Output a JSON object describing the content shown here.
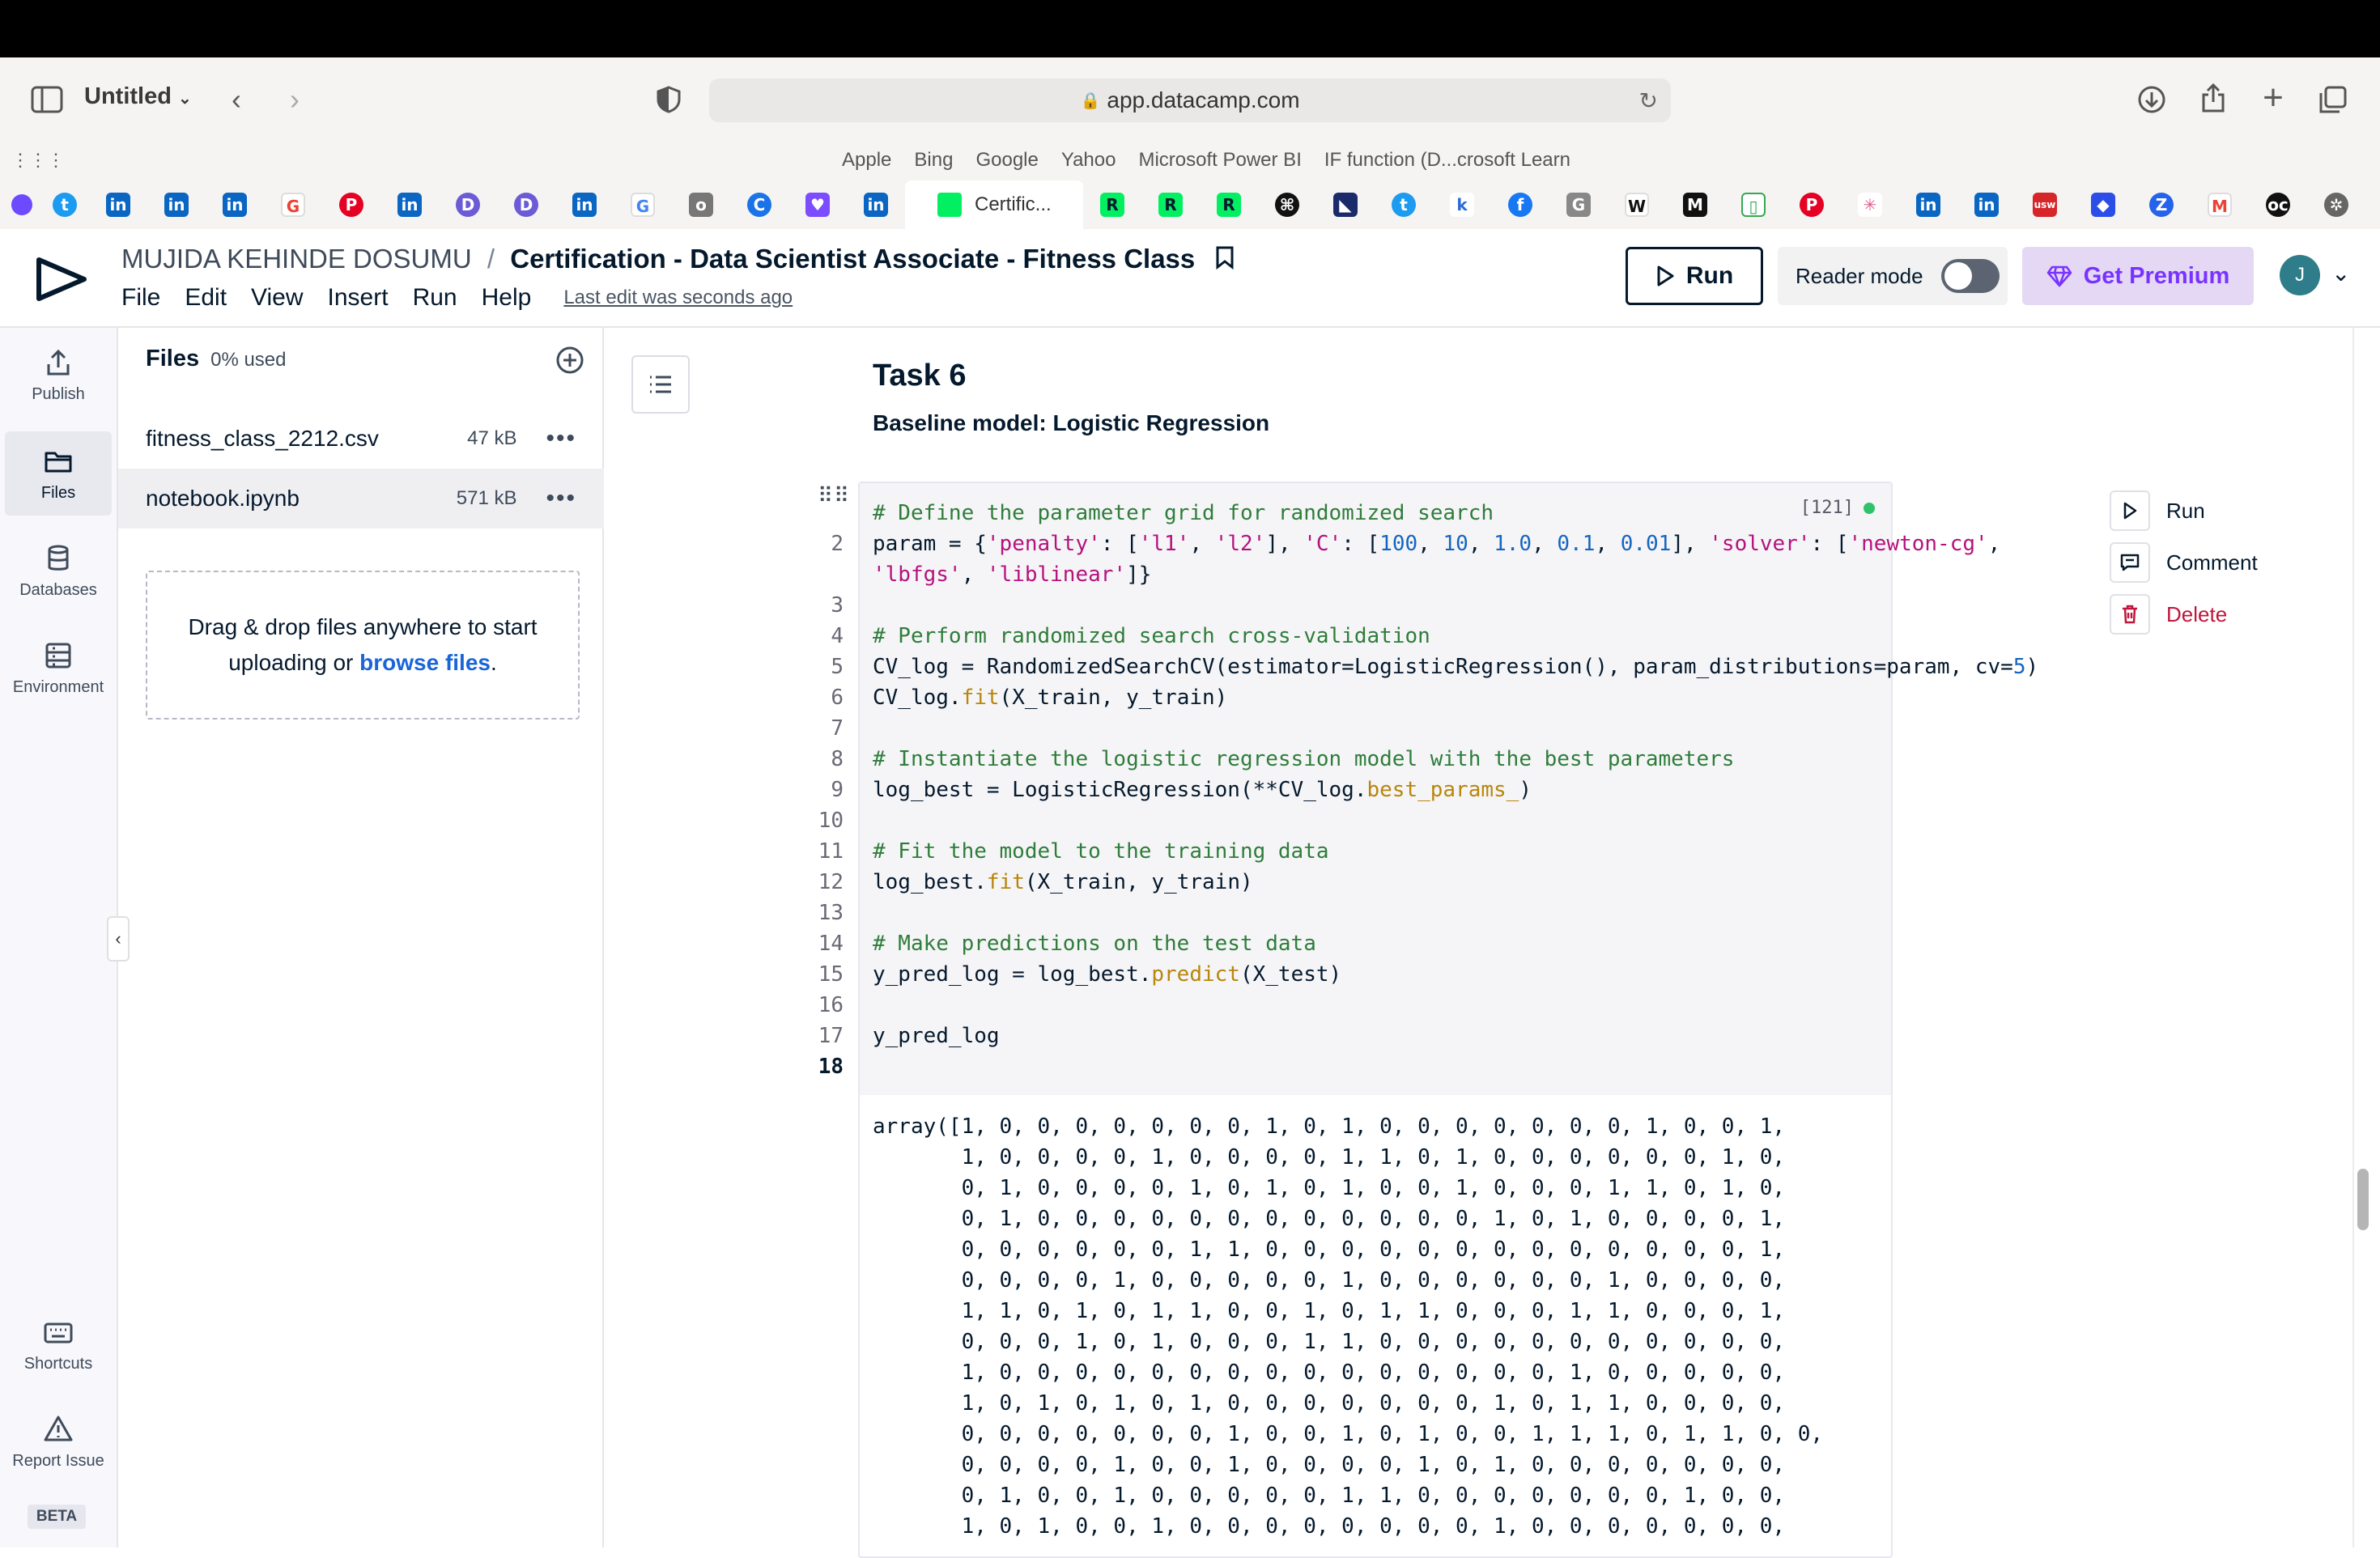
{
  "browser": {
    "tab_group": "Untitled",
    "url": "app.datacamp.com",
    "favorites": [
      "Apple",
      "Bing",
      "Google",
      "Yahoo",
      "Microsoft Power BI",
      "IF function (D...crosoft Learn"
    ],
    "active_tab": "Certific..."
  },
  "header": {
    "owner": "MUJIDA KEHINDE DOSUMU",
    "separator": "/",
    "title": "Certification - Data Scientist Associate - Fitness Class",
    "menu": [
      "File",
      "Edit",
      "View",
      "Insert",
      "Run",
      "Help"
    ],
    "last_edit": "Last edit was seconds ago",
    "run_label": "Run",
    "reader_mode_label": "Reader mode",
    "premium_label": "Get Premium",
    "avatar_initial": "J"
  },
  "left_nav": {
    "items": [
      "Publish",
      "Files",
      "Databases",
      "Environment"
    ],
    "bottom": [
      "Shortcuts",
      "Report Issue"
    ],
    "beta": "BETA"
  },
  "files_panel": {
    "title": "Files",
    "usage": "0% used",
    "files": [
      {
        "name": "fitness_class_2212.csv",
        "size": "47 kB"
      },
      {
        "name": "notebook.ipynb",
        "size": "571 kB"
      }
    ],
    "drop_text": "Drag & drop files anywhere to start uploading or",
    "drop_link": "browse files",
    "drop_end": "."
  },
  "notebook": {
    "task_title": "Task 6",
    "task_subtitle": "Baseline model: Logistic Regression",
    "exec_count": "[121]",
    "line_numbers": [
      "",
      "2",
      "",
      "3",
      "4",
      "5",
      "6",
      "7",
      "8",
      "9",
      "10",
      "11",
      "12",
      "13",
      "14",
      "15",
      "16",
      "17",
      "18"
    ],
    "output": "array([1, 0, 0, 0, 0, 0, 0, 0, 1, 0, 1, 0, 0, 0, 0, 0, 0, 0, 1, 0, 0, 1,\n       1, 0, 0, 0, 0, 1, 0, 0, 0, 0, 1, 1, 0, 1, 0, 0, 0, 0, 0, 0, 1, 0,\n       0, 1, 0, 0, 0, 0, 1, 0, 1, 0, 1, 0, 0, 1, 0, 0, 0, 1, 1, 0, 1, 0,\n       0, 1, 0, 0, 0, 0, 0, 0, 0, 0, 0, 0, 0, 0, 1, 0, 1, 0, 0, 0, 0, 1,\n       0, 0, 0, 0, 0, 0, 1, 1, 0, 0, 0, 0, 0, 0, 0, 0, 0, 0, 0, 0, 0, 1,\n       0, 0, 0, 0, 1, 0, 0, 0, 0, 0, 1, 0, 0, 0, 0, 0, 0, 1, 0, 0, 0, 0,\n       1, 1, 0, 1, 0, 1, 1, 0, 0, 1, 0, 1, 1, 0, 0, 0, 1, 1, 0, 0, 0, 1,\n       0, 0, 0, 1, 0, 1, 0, 0, 0, 1, 1, 0, 0, 0, 0, 0, 0, 0, 0, 0, 0, 0,\n       1, 0, 0, 0, 0, 0, 0, 0, 0, 0, 0, 0, 0, 0, 0, 0, 1, 0, 0, 0, 0, 0,\n       1, 0, 1, 0, 1, 0, 1, 0, 0, 0, 0, 0, 0, 0, 1, 0, 1, 1, 0, 0, 0, 0,\n       0, 0, 0, 0, 0, 0, 0, 1, 0, 0, 1, 0, 1, 0, 0, 1, 1, 1, 0, 1, 1, 0, 0,\n       0, 0, 0, 0, 1, 0, 0, 1, 0, 0, 0, 0, 1, 0, 1, 0, 0, 0, 0, 0, 0, 0,\n       0, 1, 0, 0, 1, 0, 0, 0, 0, 0, 1, 1, 0, 0, 0, 0, 0, 0, 0, 1, 0, 0,\n       1, 0, 1, 0, 0, 1, 0, 0, 0, 0, 0, 0, 0, 0, 1, 0, 0, 0, 0, 0, 0, 0,",
    "actions": {
      "run": "Run",
      "comment": "Comment",
      "delete": "Delete"
    }
  },
  "colors": {
    "accent": "#7933ff",
    "premium_bg": "#e4d8f5",
    "delete": "#c0163c",
    "status_dot": "#2ec26b"
  }
}
